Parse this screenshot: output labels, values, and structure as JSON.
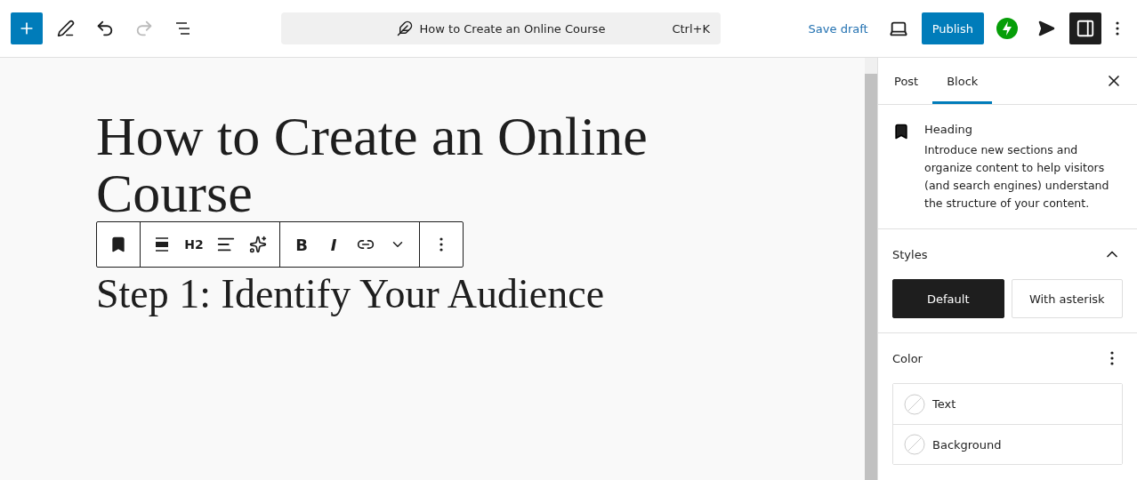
{
  "top_bar": {
    "doc_title": "How to Create an Online Course",
    "shortcut": "Ctrl+K",
    "save_draft": "Save draft",
    "publish": "Publish",
    "redo_disabled": true,
    "settings_on": true
  },
  "editor": {
    "title": "How to Create an Online Course",
    "heading": "Step 1: Identify Your Audience",
    "toolbar_groups": [
      [
        {
          "kind": "bookmark"
        }
      ],
      [
        {
          "kind": "align"
        },
        {
          "kind": "text",
          "label": "H2"
        },
        {
          "kind": "textalign"
        },
        {
          "kind": "sparkle"
        }
      ],
      [
        {
          "kind": "bold",
          "label": "B"
        },
        {
          "kind": "italic",
          "label": "I"
        },
        {
          "kind": "link"
        },
        {
          "kind": "chevron"
        }
      ],
      [
        {
          "kind": "more"
        }
      ]
    ]
  },
  "sidebar": {
    "tabs": [
      {
        "label": "Post",
        "selected": false
      },
      {
        "label": "Block",
        "selected": true
      }
    ],
    "block": {
      "name": "Heading",
      "description": "Introduce new sections and organize content to help visitors (and search engines) understand the structure of your content."
    },
    "styles": {
      "title": "Styles",
      "expanded": true,
      "options": [
        {
          "label": "Default",
          "selected": true
        },
        {
          "label": "With asterisk",
          "selected": false
        }
      ]
    },
    "color": {
      "title": "Color",
      "items": [
        {
          "label": "Text"
        },
        {
          "label": "Background"
        }
      ]
    }
  }
}
